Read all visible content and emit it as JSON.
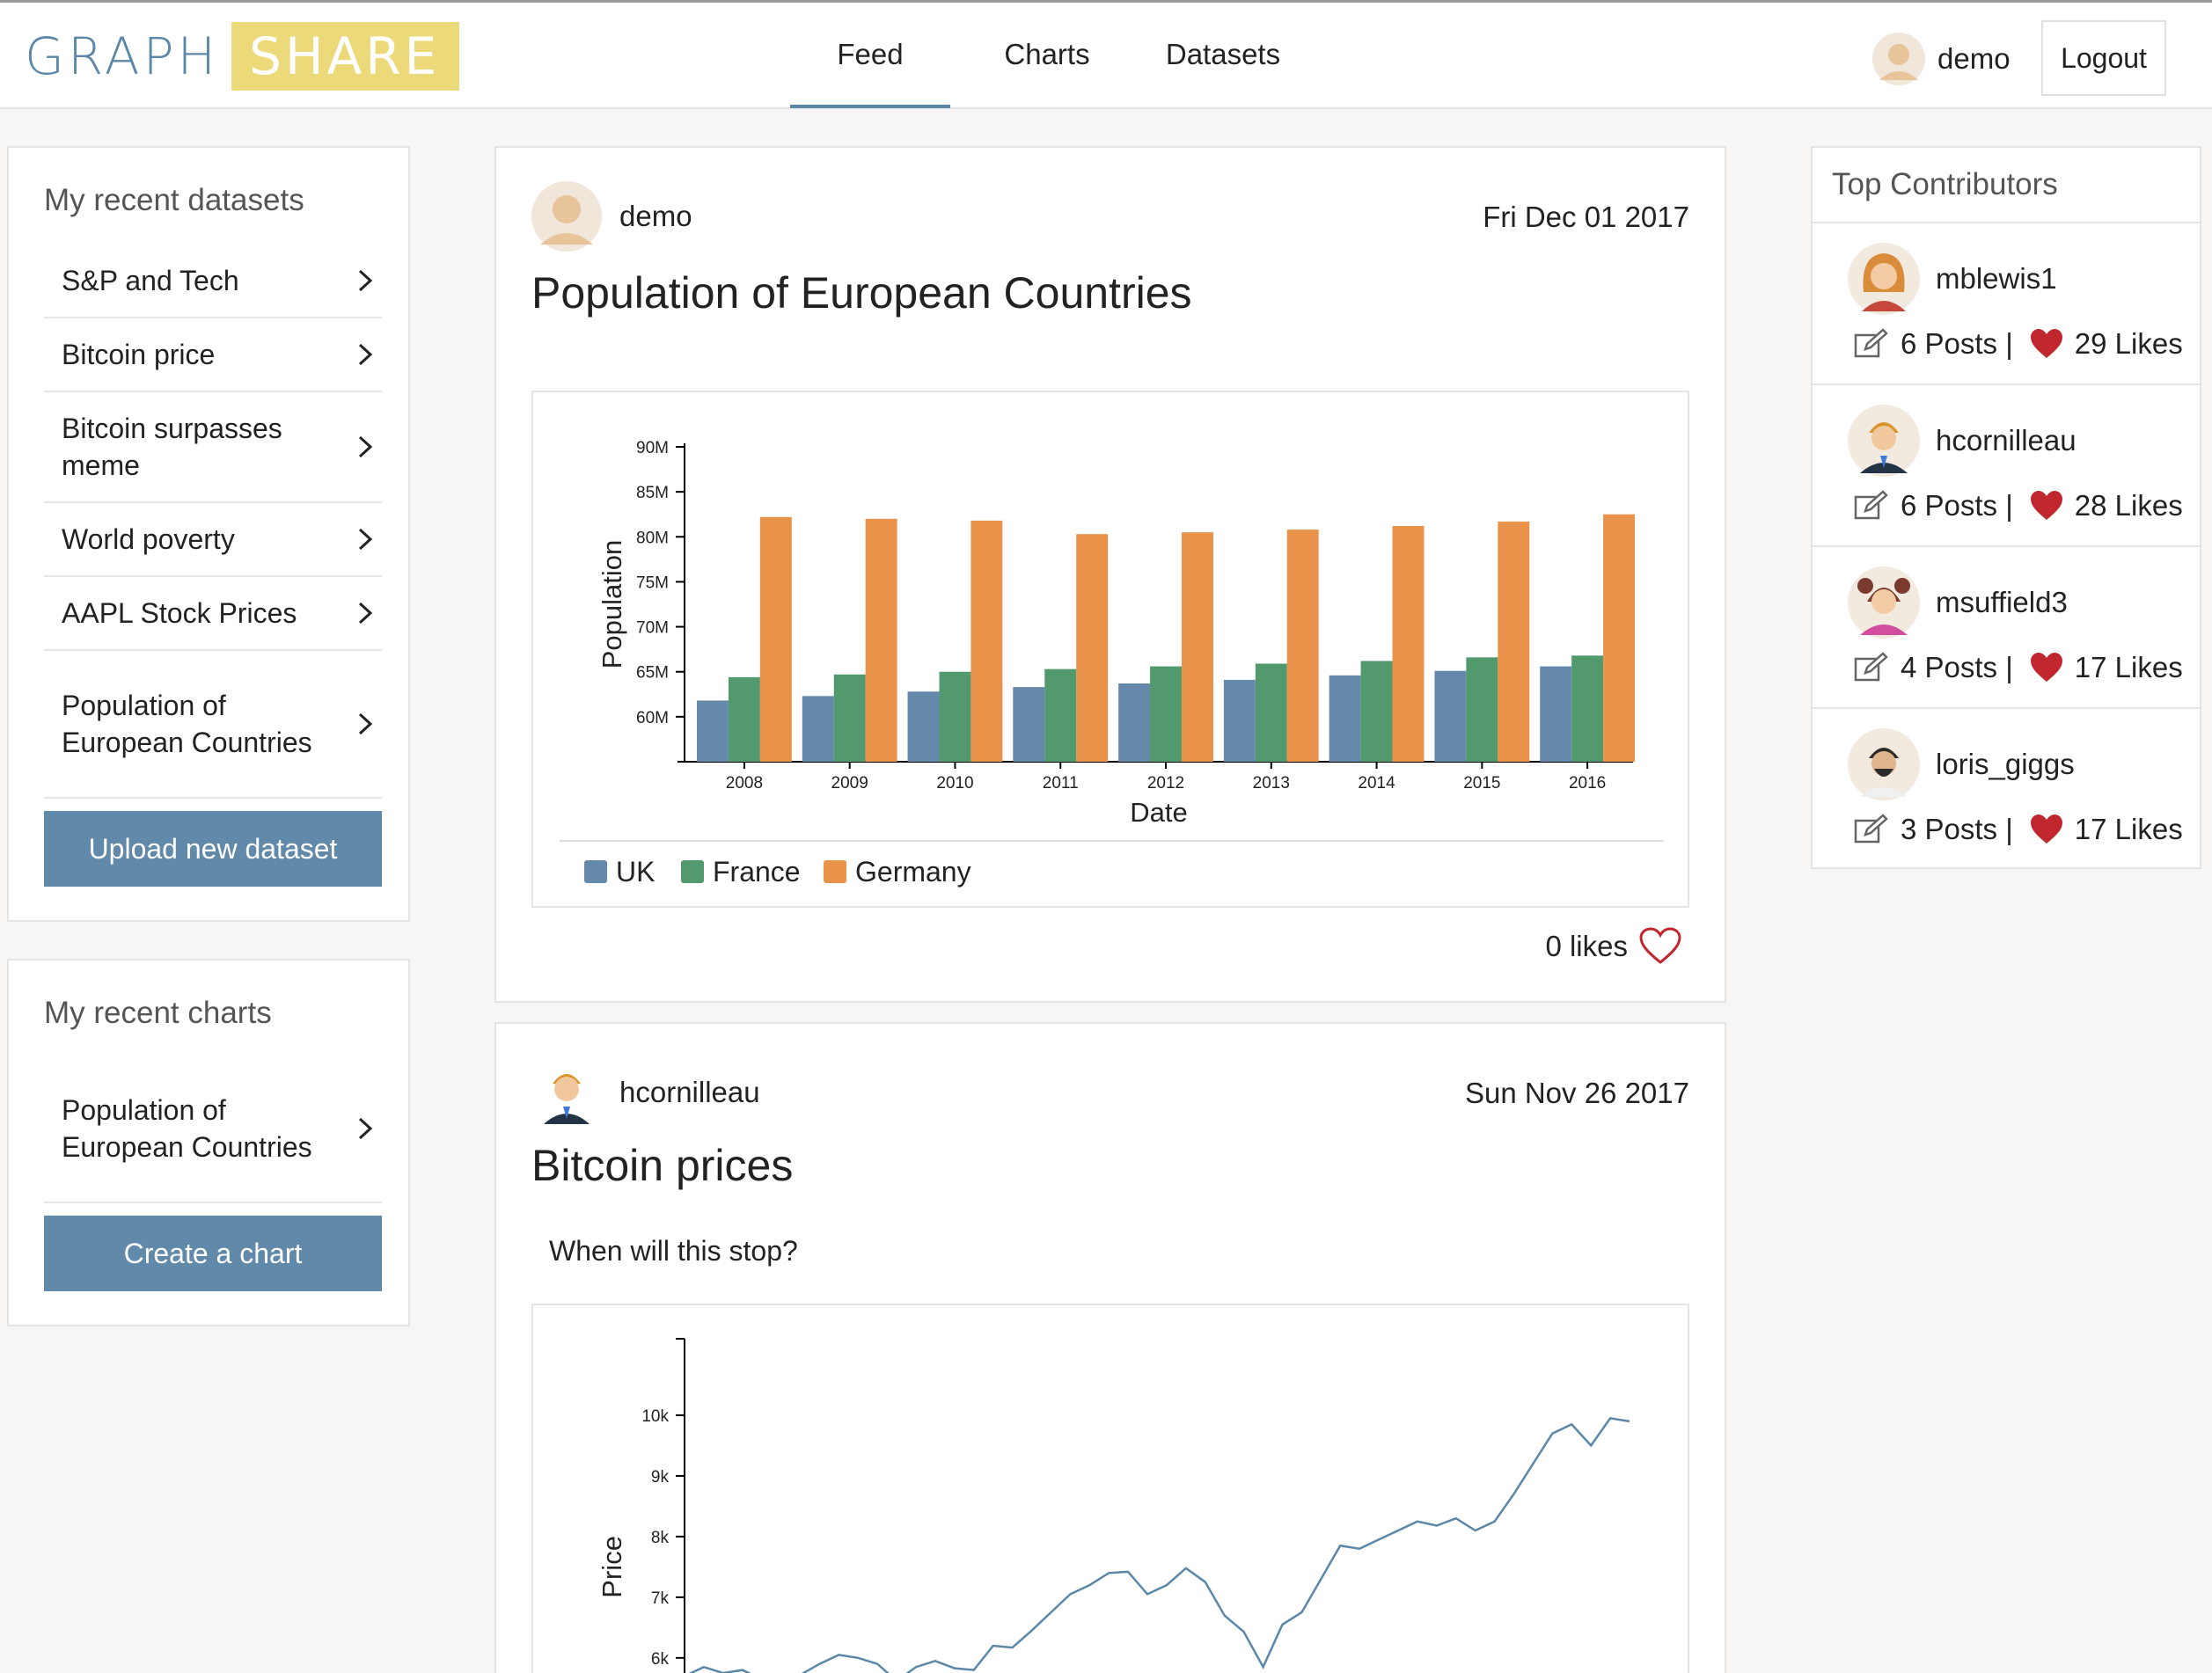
{
  "brand": {
    "logo_word1": "GRAPH",
    "logo_word2": "SHARE",
    "accent": "#5b87a9",
    "logo_color": "#ecd97a"
  },
  "nav": {
    "tabs": [
      {
        "label": "Feed",
        "active": true
      },
      {
        "label": "Charts"
      },
      {
        "label": "Datasets"
      }
    ]
  },
  "user": {
    "name": "demo",
    "logout_label": "Logout"
  },
  "datasets_panel": {
    "title": "My recent datasets",
    "items": [
      {
        "label": "S&P and Tech"
      },
      {
        "label": "Bitcoin price"
      },
      {
        "label": "Bitcoin surpasses meme"
      },
      {
        "label": "World poverty"
      },
      {
        "label": "AAPL Stock Prices"
      },
      {
        "label": "Population of European Countries"
      }
    ],
    "button_label": "Upload new dataset"
  },
  "charts_panel": {
    "title": "My recent charts",
    "items": [
      {
        "label": "Population of European Countries"
      }
    ],
    "button_label": "Create a chart"
  },
  "posts": [
    {
      "author": "demo",
      "date": "Fri Dec 01 2017",
      "title": "Population of European Countries",
      "likes_text": "0 likes"
    },
    {
      "author": "hcornilleau",
      "date": "Sun Nov 26 2017",
      "title": "Bitcoin prices",
      "description": "When will this stop?"
    }
  ],
  "contributors_panel": {
    "title": "Top Contributors",
    "items": [
      {
        "name": "mblewis1",
        "posts": "6 Posts |",
        "likes": "29 Likes"
      },
      {
        "name": "hcornilleau",
        "posts": "6 Posts |",
        "likes": "28 Likes"
      },
      {
        "name": "msuffield3",
        "posts": "4 Posts |",
        "likes": "17 Likes"
      },
      {
        "name": "loris_giggs",
        "posts": "3 Posts |",
        "likes": "17 Likes"
      }
    ]
  },
  "icons": {
    "chevron": "chevron-right-icon",
    "like": "heart-outline-icon",
    "posts": "edit-icon",
    "likes": "heart-icon"
  },
  "colors": {
    "uk": "#6589ab",
    "france": "#529a6e",
    "germany": "#e8924a",
    "heart": "#c0282d",
    "line": "#5b87a9"
  },
  "chart_data": [
    {
      "type": "bar",
      "xlabel": "Date",
      "ylabel": "Population",
      "categories": [
        "2008",
        "2009",
        "2010",
        "2011",
        "2012",
        "2013",
        "2014",
        "2015",
        "2016"
      ],
      "ylim": [
        55000000,
        90000000
      ],
      "yticks": [
        60000000,
        65000000,
        70000000,
        75000000,
        80000000,
        85000000,
        90000000
      ],
      "ytick_labels": [
        "60M",
        "65M",
        "70M",
        "75M",
        "80M",
        "85M",
        "90M"
      ],
      "legend": "bottom-left",
      "series": [
        {
          "name": "UK",
          "values": [
            61800000,
            62300000,
            62800000,
            63300000,
            63700000,
            64100000,
            64600000,
            65100000,
            65600000
          ]
        },
        {
          "name": "France",
          "values": [
            64400000,
            64700000,
            65000000,
            65300000,
            65600000,
            65900000,
            66200000,
            66600000,
            66800000
          ]
        },
        {
          "name": "Germany",
          "values": [
            82200000,
            82000000,
            81800000,
            80300000,
            80500000,
            80800000,
            81200000,
            81700000,
            82500000
          ]
        }
      ]
    },
    {
      "type": "line",
      "ylabel": "Price",
      "yticks": [
        6000,
        7000,
        8000,
        9000,
        10000
      ],
      "ytick_labels": [
        "6k",
        "7k",
        "8k",
        "9k",
        "10k"
      ],
      "ylim": [
        5200,
        11000
      ],
      "values": [
        5700,
        5850,
        5750,
        5800,
        5650,
        5620,
        5720,
        5900,
        6050,
        6000,
        5900,
        5620,
        5850,
        5950,
        5830,
        5800,
        6200,
        6170,
        6450,
        6750,
        7050,
        7200,
        7400,
        7420,
        7050,
        7200,
        7480,
        7250,
        6700,
        6430,
        5850,
        6550,
        6750,
        7300,
        7850,
        7800,
        7950,
        8100,
        8250,
        8180,
        8300,
        8100,
        8250,
        8700,
        9200,
        9700,
        9850,
        9500,
        9950,
        9900
      ]
    }
  ]
}
